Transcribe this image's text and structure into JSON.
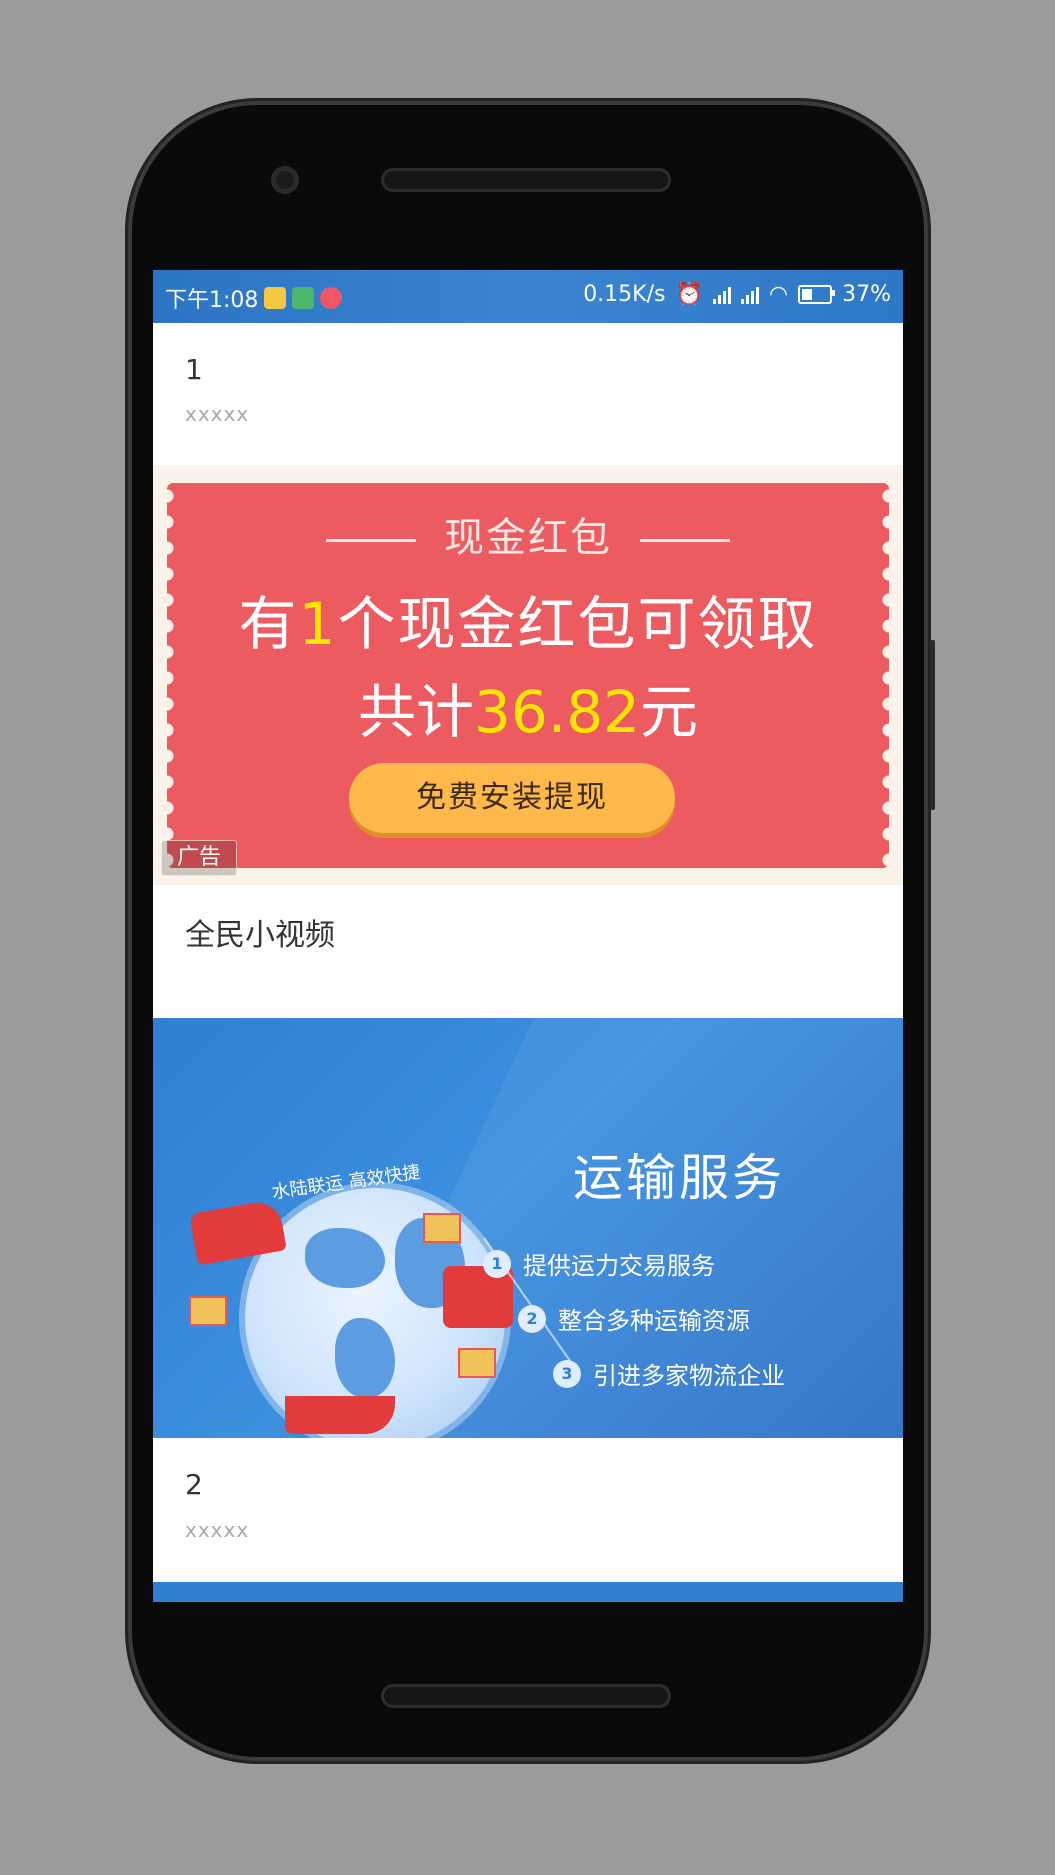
{
  "status_bar": {
    "time": "下午1:08",
    "network_speed": "0.15K/s",
    "battery": "37%",
    "icons": [
      "video-app-icon",
      "video-app-icon",
      "bunny-app-icon",
      "alarm-icon",
      "signal-icon",
      "signal-icon",
      "wifi-icon",
      "battery-icon"
    ]
  },
  "feed": {
    "items": [
      {
        "title": "1",
        "subtitle": "xxxxx"
      },
      {
        "title": "2",
        "subtitle": "xxxxx"
      }
    ],
    "ad": {
      "heading": "现金红包",
      "line1_prefix": "有",
      "line1_highlight": "1",
      "line1_suffix": "个现金红包可领取",
      "line2_prefix": "共计",
      "line2_highlight": "36.82",
      "line2_suffix": "元",
      "button_label": "免费安装提现",
      "badge": "广告",
      "colors": {
        "background": "#ec5b60",
        "highlight": "#ffe600",
        "button": "#ffb84a"
      }
    },
    "video_section_title": "全民小视频",
    "banner": {
      "title": "运输服务",
      "slogan": "水陆联运 高效快捷",
      "features": [
        {
          "num": "1",
          "text": "提供运力交易服务"
        },
        {
          "num": "2",
          "text": "整合多种运输资源"
        },
        {
          "num": "3",
          "text": "引进多家物流企业"
        }
      ],
      "accent": "#2f7fd3"
    }
  }
}
